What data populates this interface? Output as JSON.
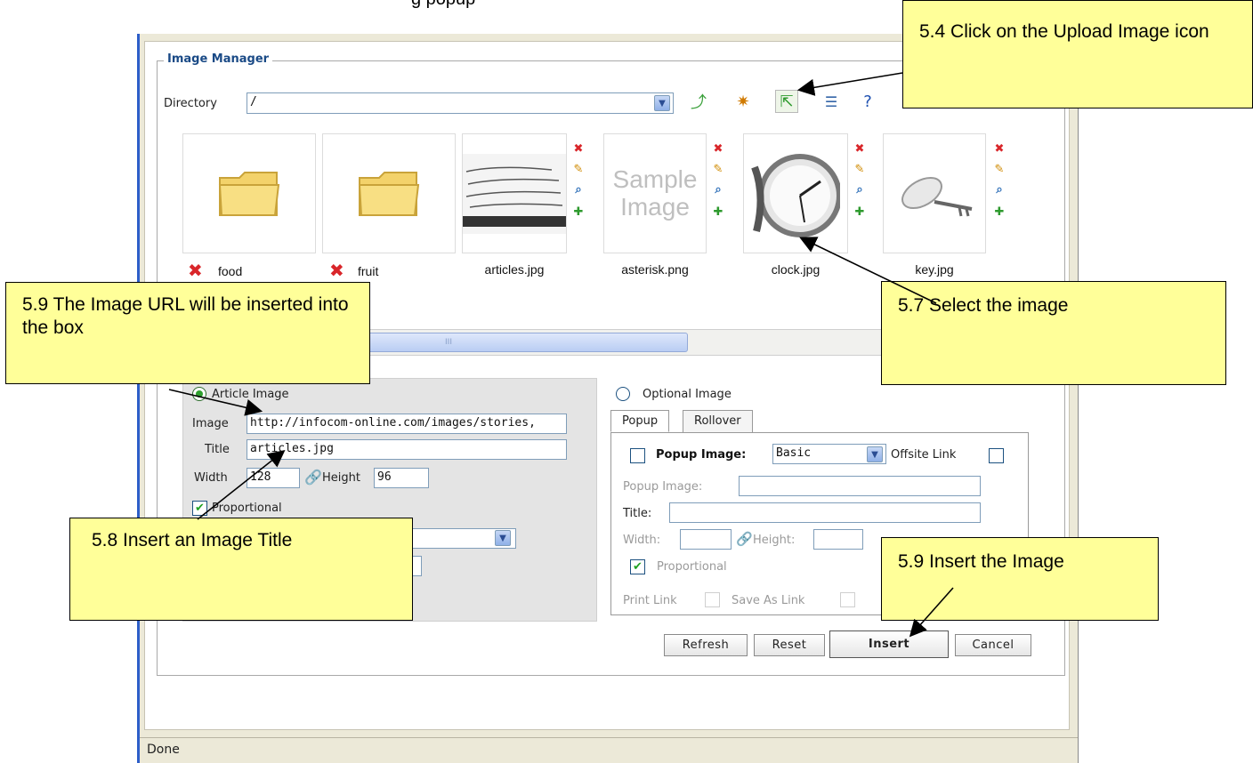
{
  "header_text": "g popup",
  "dialog": {
    "legend": "Image Manager",
    "directory_label": "Directory",
    "directory_value": "/",
    "toolbar_icons": [
      "up-directory-icon",
      "new-folder-icon",
      "upload-image-icon",
      "view-list-icon",
      "help-icon"
    ],
    "items": [
      {
        "name": "food",
        "kind": "folder"
      },
      {
        "name": "fruit",
        "kind": "folder"
      },
      {
        "name": "articles.jpg",
        "kind": "image"
      },
      {
        "name": "asterisk.png",
        "kind": "image",
        "placeholder": [
          "Sample",
          "Image"
        ]
      },
      {
        "name": "clock.jpg",
        "kind": "image"
      },
      {
        "name": "key.jpg",
        "kind": "image"
      }
    ],
    "scrollbar_glyph": "III",
    "article": {
      "radio_label": "Article Image",
      "image_label": "Image",
      "image_value": "http://infocom-online.com/images/stories,",
      "title_label": "Title",
      "title_value": "articles.jpg",
      "width_label": "Width",
      "width_value": "128",
      "height_label": "Height",
      "height_value": "96",
      "proportional_label": "Proportional",
      "proportional_checked": true
    },
    "optional": {
      "radio_label": "Optional Image",
      "tabs": [
        "Popup",
        "Rollover"
      ],
      "popup_image_label": "Popup Image:",
      "popup_image_select": "Basic",
      "offsite_link_label": "Offsite Link",
      "popup_image_field_label": "Popup Image:",
      "title_label": "Title:",
      "width_label": "Width:",
      "height_label": "Height:",
      "proportional_label": "Proportional",
      "print_link_label": "Print Link",
      "save_as_link_label": "Save As Link"
    },
    "buttons": {
      "refresh": "Refresh",
      "reset": "Reset",
      "insert": "Insert",
      "cancel": "Cancel"
    },
    "status": "Done"
  },
  "callouts": {
    "upload": "5.4 Click on the Upload Image icon",
    "url": "5.9 The Image URL will be inserted into the box",
    "select": "5.7 Select the image",
    "title": "5.8 Insert an Image Title",
    "insert": "5.9 Insert the Image"
  },
  "colors": {
    "callout_bg": "#ffff99",
    "window_border": "#2d5ec9",
    "legend": "#1a4a86",
    "check": "#21a121",
    "delete": "#d9262a"
  }
}
